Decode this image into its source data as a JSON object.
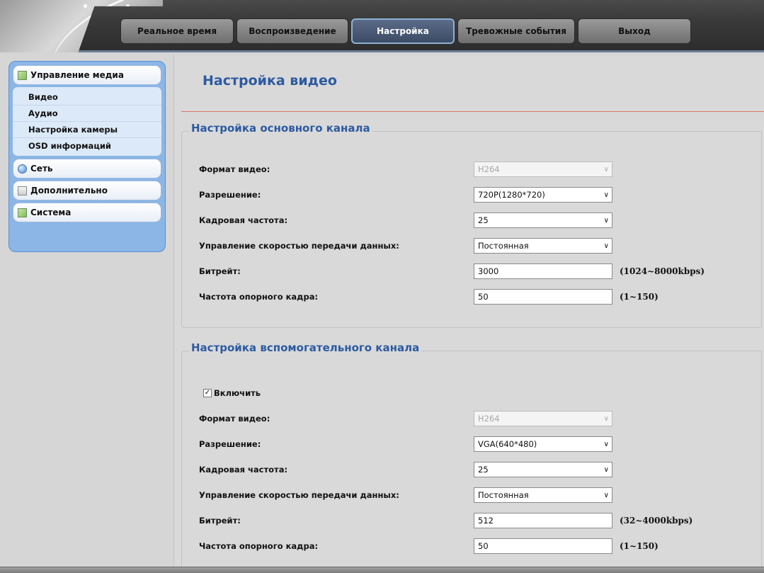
{
  "nav": {
    "tabs": [
      {
        "label": "Реальное время"
      },
      {
        "label": "Воспроизведение"
      },
      {
        "label": "Настройка"
      },
      {
        "label": "Тревожные события"
      },
      {
        "label": "Выход"
      }
    ],
    "active_index": 2
  },
  "sidebar": {
    "sections": [
      {
        "label": "Управление медиа",
        "icon": "media-icon",
        "items": [
          "Видео",
          "Аудио",
          "Настройка камеры",
          "OSD информаций"
        ]
      },
      {
        "label": "Сеть",
        "icon": "network-icon"
      },
      {
        "label": "Дополнительно",
        "icon": "advanced-icon"
      },
      {
        "label": "Система",
        "icon": "system-icon"
      }
    ]
  },
  "page": {
    "title": "Настройка видео"
  },
  "main_channel": {
    "legend": "Настройка основного канала",
    "video_format": {
      "label": "Формат видео:",
      "value": "H264"
    },
    "resolution": {
      "label": "Разрешение:",
      "value": "720P(1280*720)"
    },
    "frame_rate": {
      "label": "Кадровая частота:",
      "value": "25"
    },
    "rate_control": {
      "label": "Управление скоростью передачи данных:",
      "value": "Постоянная"
    },
    "bitrate": {
      "label": "Битрейт:",
      "value": "3000",
      "hint": "(1024~8000kbps)"
    },
    "gop": {
      "label": "Частота опорного кадра:",
      "value": "50",
      "hint": "(1~150)"
    }
  },
  "sub_channel": {
    "legend": "Настройка вспомогательного канала",
    "enable": {
      "label": "Включить",
      "checked": true,
      "mark": "✓"
    },
    "video_format": {
      "label": "Формат видео:",
      "value": "H264"
    },
    "resolution": {
      "label": "Разрешение:",
      "value": "VGA(640*480)"
    },
    "frame_rate": {
      "label": "Кадровая частота:",
      "value": "25"
    },
    "rate_control": {
      "label": "Управление скоростью передачи данных:",
      "value": "Постоянная"
    },
    "bitrate": {
      "label": "Битрейт:",
      "value": "512",
      "hint": "(32~4000kbps)"
    },
    "gop": {
      "label": "Частота опорного кадра:",
      "value": "50",
      "hint": "(1~150)"
    }
  },
  "colors": {
    "accent": "#2c5aa0",
    "sidebar_bg": "#8bb6e6",
    "separator": "#d8756a"
  }
}
